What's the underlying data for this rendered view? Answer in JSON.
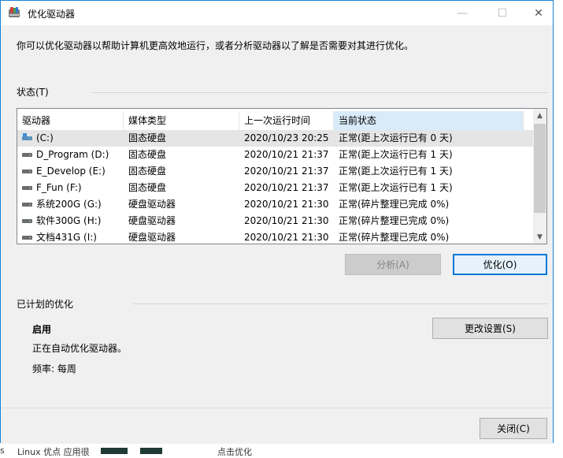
{
  "window": {
    "title": "优化驱动器",
    "minimize": "—",
    "maximize": "☐",
    "close": "✕"
  },
  "description": "你可以优化驱动器以帮助计算机更高效地运行，或者分析驱动器以了解是否需要对其进行优化。",
  "status": {
    "label": "状态(T)",
    "columns": [
      "驱动器",
      "媒体类型",
      "上一次运行时间",
      "当前状态"
    ],
    "rows": [
      {
        "drive": "(C:)",
        "media": "固态硬盘",
        "last_run": "2020/10/23 20:25",
        "state": "正常(距上次运行已有 0 天)"
      },
      {
        "drive": "D_Program (D:)",
        "media": "固态硬盘",
        "last_run": "2020/10/21 21:37",
        "state": "正常(距上次运行已有 1 天)"
      },
      {
        "drive": "E_Develop (E:)",
        "media": "固态硬盘",
        "last_run": "2020/10/21 21:37",
        "state": "正常(距上次运行已有 1 天)"
      },
      {
        "drive": "F_Fun (F:)",
        "media": "固态硬盘",
        "last_run": "2020/10/21 21:37",
        "state": "正常(距上次运行已有 1 天)"
      },
      {
        "drive": "系统200G (G:)",
        "media": "硬盘驱动器",
        "last_run": "2020/10/21 21:30",
        "state": "正常(碎片整理已完成 0%)"
      },
      {
        "drive": "软件300G (H:)",
        "media": "硬盘驱动器",
        "last_run": "2020/10/21 21:30",
        "state": "正常(碎片整理已完成 0%)"
      },
      {
        "drive": "文档431G (I:)",
        "media": "硬盘驱动器",
        "last_run": "2020/10/21 21:30",
        "state": "正常(碎片整理已完成 0%)"
      }
    ],
    "analyze_button": "分析(A)",
    "optimize_button": "优化(O)"
  },
  "scheduled": {
    "label": "已计划的优化",
    "state": "启用",
    "info": "正在自动优化驱动器。",
    "frequency": "频率: 每周",
    "change_button": "更改设置(S)"
  },
  "footer": {
    "close_button": "关闭(C)"
  },
  "background": {
    "bottom_text_1": "Linux 优点 应用很",
    "bottom_text_2": "点击优化"
  }
}
